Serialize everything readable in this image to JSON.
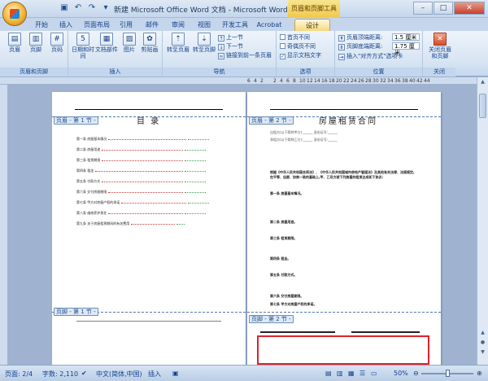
{
  "window": {
    "title": "新建 Microsoft Office Word 文档 - Microsoft Word",
    "context_title": "页眉和页脚工具",
    "buttons": [
      "–",
      "□",
      "✕"
    ]
  },
  "tabs": [
    "开始",
    "插入",
    "页面布局",
    "引用",
    "邮件",
    "审阅",
    "视图",
    "开发工具",
    "Acrobat",
    "设计"
  ],
  "active_tab": "设计",
  "ribbon": {
    "groups": [
      "页眉和页脚",
      "插入",
      "导航",
      "选项",
      "位置",
      "关闭"
    ],
    "header_footer": [
      "页眉",
      "页脚",
      "页码"
    ],
    "insert": [
      "日期和时间",
      "文档部件",
      "图片",
      "剪贴画"
    ],
    "nav_big": [
      "转至页眉",
      "转至页脚"
    ],
    "nav_small": [
      "上一节",
      "下一节",
      "链接到前一条页眉"
    ],
    "options": [
      "首页不同",
      "奇偶页不同",
      "显示文档文字"
    ],
    "options_checked": [
      false,
      false,
      true
    ],
    "position": {
      "header_label": "页眉顶端距离:",
      "header_value": "1.5 厘米",
      "footer_label": "页脚底端距离:",
      "footer_value": "1.75 厘米",
      "align_label": "插入\"对齐方式\"选项卡"
    },
    "close_label": "关闭页眉和页脚"
  },
  "ruler": [
    "6",
    "4",
    "2",
    "",
    "2",
    "4",
    "6",
    "8",
    "10",
    "12",
    "14",
    "16",
    "18",
    "20",
    "22",
    "24",
    "26",
    "28",
    "30",
    "32",
    "34",
    "36",
    "38",
    "40",
    "42",
    "44"
  ],
  "page1": {
    "header_tag": "页眉 - 第 1 节 -",
    "title": "目 录",
    "toc": [
      "第一条  房屋基本情况",
      "第二条  房屋用途",
      "第三条  租赁期限",
      "第四条  租金",
      "第五条  付款方式",
      "第六条  交付房屋期限",
      "第七条  甲方对房屋产权的承诺",
      "第八条  维修养护责任",
      "第九条  关于房屋租赁期间的有关费用"
    ],
    "footer_tag": "页脚 - 第 1 节 -"
  },
  "page2": {
    "header_tag": "页眉 - 第 2 节 -",
    "title": "房屋租赁合同",
    "paragraphs": [
      "出租方(以下简称甲方):______ 身份证号:______",
      "承租方(以下简称乙方):______ 身份证号:______",
      "根据《中华人民共和国合同法》、《中华人民共和国城市房地产管理法》及其他有关法律、法规规定,在平等、自愿、协商一致的基础上,甲、乙双方就下列房屋的租赁达成如下协议:",
      "第一条 房屋基本情况。",
      "第二条 房屋用途。",
      "第三条 租赁期限。",
      "第四条 租金。",
      "第五条 付款方式。",
      "第六条 交付房屋期限。",
      "第七条 甲方对房屋产权的承诺。"
    ],
    "footer_tag": "页脚 - 第 2 节 -"
  },
  "status": {
    "page": "页面: 2/4",
    "words": "字数: 2,110",
    "language": "中文(简体,中国)",
    "mode": "插入",
    "zoom": "50%"
  }
}
